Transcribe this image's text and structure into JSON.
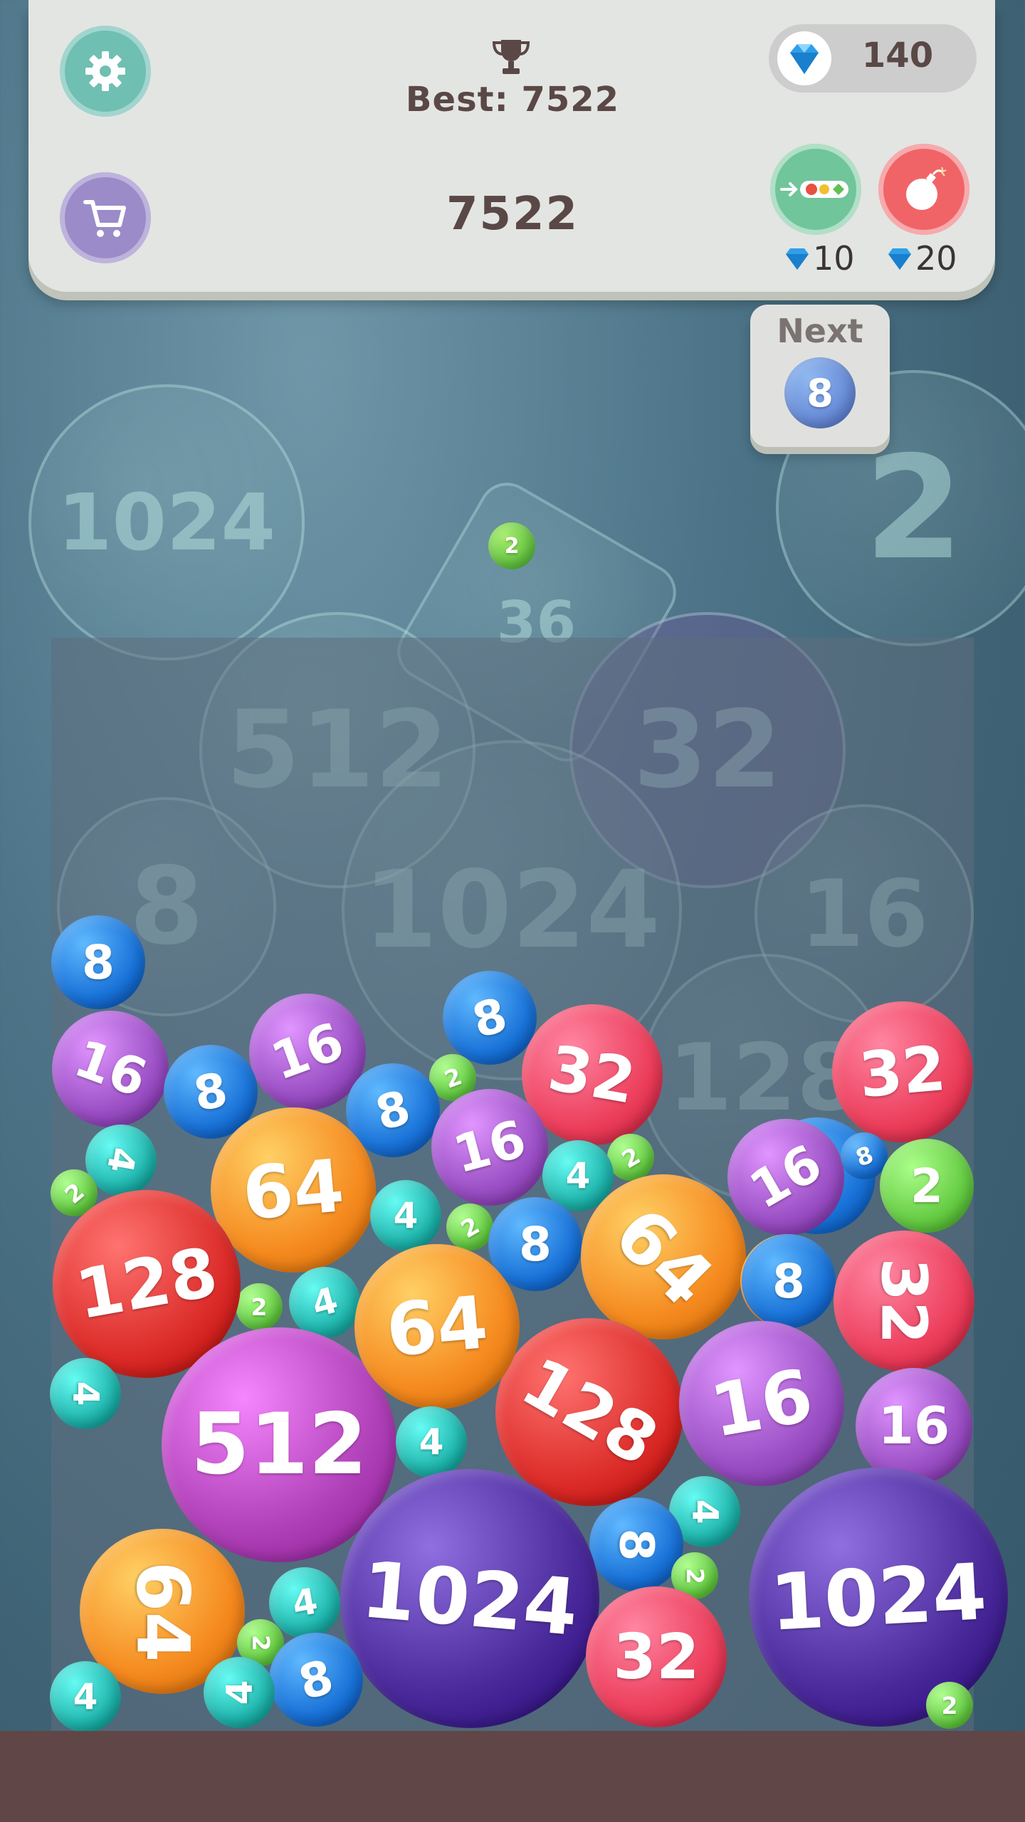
{
  "hud": {
    "best_label": "Best: 7522",
    "score": "7522",
    "gems": "140",
    "swap_cost": "10",
    "bomb_cost": "20",
    "icons": {
      "settings": "gear-icon",
      "shop": "cart-icon",
      "trophy": "trophy-icon",
      "gem": "diamond-icon",
      "swap": "swap-icon",
      "bomb": "bomb-icon"
    }
  },
  "next": {
    "label": "Next",
    "value": "8"
  },
  "dropper_ball": "2",
  "background_labels": [
    "1024",
    "2",
    "36",
    "512",
    "32",
    "8",
    "1024",
    "16",
    "128"
  ],
  "ball_colors": {
    "2": "#66cc44",
    "4": "#20b5ad",
    "8": "#1a73d8",
    "16": "#9a4fc4",
    "32": "#ec3f5c",
    "64": "#f58a1f",
    "128": "#dc2d2a",
    "512": "#b040b8",
    "1024": "#4a2a9a"
  },
  "board": [
    {
      "v": "8"
    },
    {
      "v": "16"
    },
    {
      "v": "16"
    },
    {
      "v": "8"
    },
    {
      "v": "8"
    },
    {
      "v": "2"
    },
    {
      "v": "8"
    },
    {
      "v": "32"
    },
    {
      "v": "32"
    },
    {
      "v": "4"
    },
    {
      "v": "2"
    },
    {
      "v": "64"
    },
    {
      "v": "16"
    },
    {
      "v": "8"
    },
    {
      "v": "4"
    },
    {
      "v": "2"
    },
    {
      "v": "16"
    },
    {
      "v": "2"
    },
    {
      "v": "8"
    },
    {
      "v": "4"
    },
    {
      "v": "2"
    },
    {
      "v": "8"
    },
    {
      "v": "64"
    },
    {
      "v": "128"
    },
    {
      "v": "2"
    },
    {
      "v": "4"
    },
    {
      "v": "64"
    },
    {
      "v": "8"
    },
    {
      "v": "32"
    },
    {
      "v": "4"
    },
    {
      "v": "512"
    },
    {
      "v": "128"
    },
    {
      "v": "64"
    },
    {
      "v": "16"
    },
    {
      "v": "4"
    },
    {
      "v": "16"
    },
    {
      "v": "1024"
    },
    {
      "v": "4"
    },
    {
      "v": "8"
    },
    {
      "v": "1024"
    },
    {
      "v": "2"
    },
    {
      "v": "64"
    },
    {
      "v": "4"
    },
    {
      "v": "2"
    },
    {
      "v": "32"
    },
    {
      "v": "8"
    },
    {
      "v": "4"
    },
    {
      "v": "4"
    },
    {
      "v": "2"
    }
  ]
}
